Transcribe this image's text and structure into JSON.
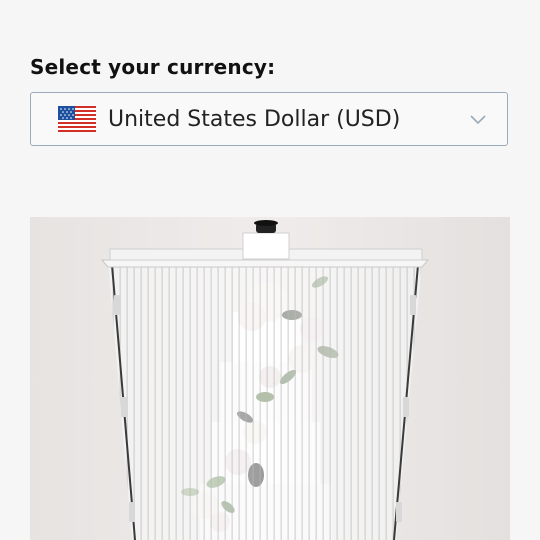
{
  "currency": {
    "label": "Select your currency:",
    "selected": "United States Dollar (USD)",
    "flag_icon": "us-flag-icon",
    "dropdown_icon": "chevron-down-icon"
  },
  "product_image": {
    "icon": "cake-display-case-image"
  },
  "colors": {
    "background": "#f6f6f6",
    "select_border": "#9aaabd",
    "text": "#111111"
  }
}
